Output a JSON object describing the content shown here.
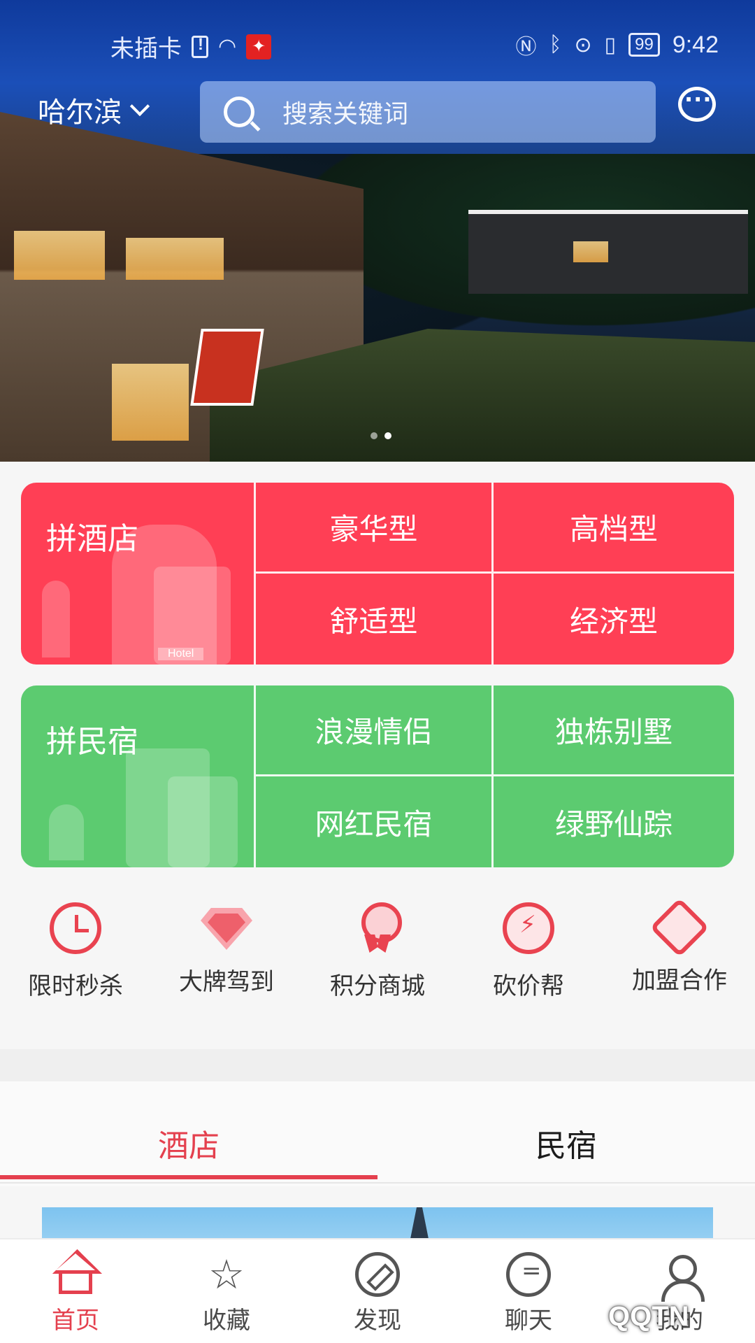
{
  "status_bar": {
    "carrier": "未插卡",
    "battery": "99",
    "time": "9:42",
    "icons": [
      "sim-alert-icon",
      "wifi-icon",
      "app-notify-icon",
      "nfc-icon",
      "bluetooth-icon",
      "location-icon",
      "vibrate-icon",
      "battery-icon"
    ]
  },
  "header": {
    "city": "哈尔滨",
    "search_placeholder": "搜索关键词"
  },
  "banner": {
    "page_count": 2,
    "active_page": 1
  },
  "hotel_category": {
    "title": "拼酒店",
    "badge": "Hotel",
    "options": [
      "豪华型",
      "高档型",
      "舒适型",
      "经济型"
    ],
    "color": "#ff3f55"
  },
  "homestay_category": {
    "title": "拼民宿",
    "options": [
      "浪漫情侣",
      "独栋别墅",
      "网红民宿",
      "绿野仙踪"
    ],
    "color": "#5ccb70"
  },
  "quick_links": [
    {
      "label": "限时秒杀",
      "icon": "alarm-clock-icon"
    },
    {
      "label": "大牌驾到",
      "icon": "diamond-icon"
    },
    {
      "label": "积分商城",
      "icon": "medal-icon"
    },
    {
      "label": "砍价帮",
      "icon": "lightning-icon"
    },
    {
      "label": "加盟合作",
      "icon": "handshake-icon"
    }
  ],
  "tabs": [
    {
      "label": "酒店",
      "active": true
    },
    {
      "label": "民宿",
      "active": false
    }
  ],
  "bottom_nav": [
    {
      "label": "首页",
      "icon": "home-icon",
      "active": true
    },
    {
      "label": "收藏",
      "icon": "star-icon",
      "active": false
    },
    {
      "label": "发现",
      "icon": "compass-icon",
      "active": false
    },
    {
      "label": "聊天",
      "icon": "chat-icon",
      "active": false
    },
    {
      "label": "我的",
      "icon": "user-icon",
      "active": false
    }
  ],
  "watermark": "QQTN",
  "accent_color": "#e4404e"
}
